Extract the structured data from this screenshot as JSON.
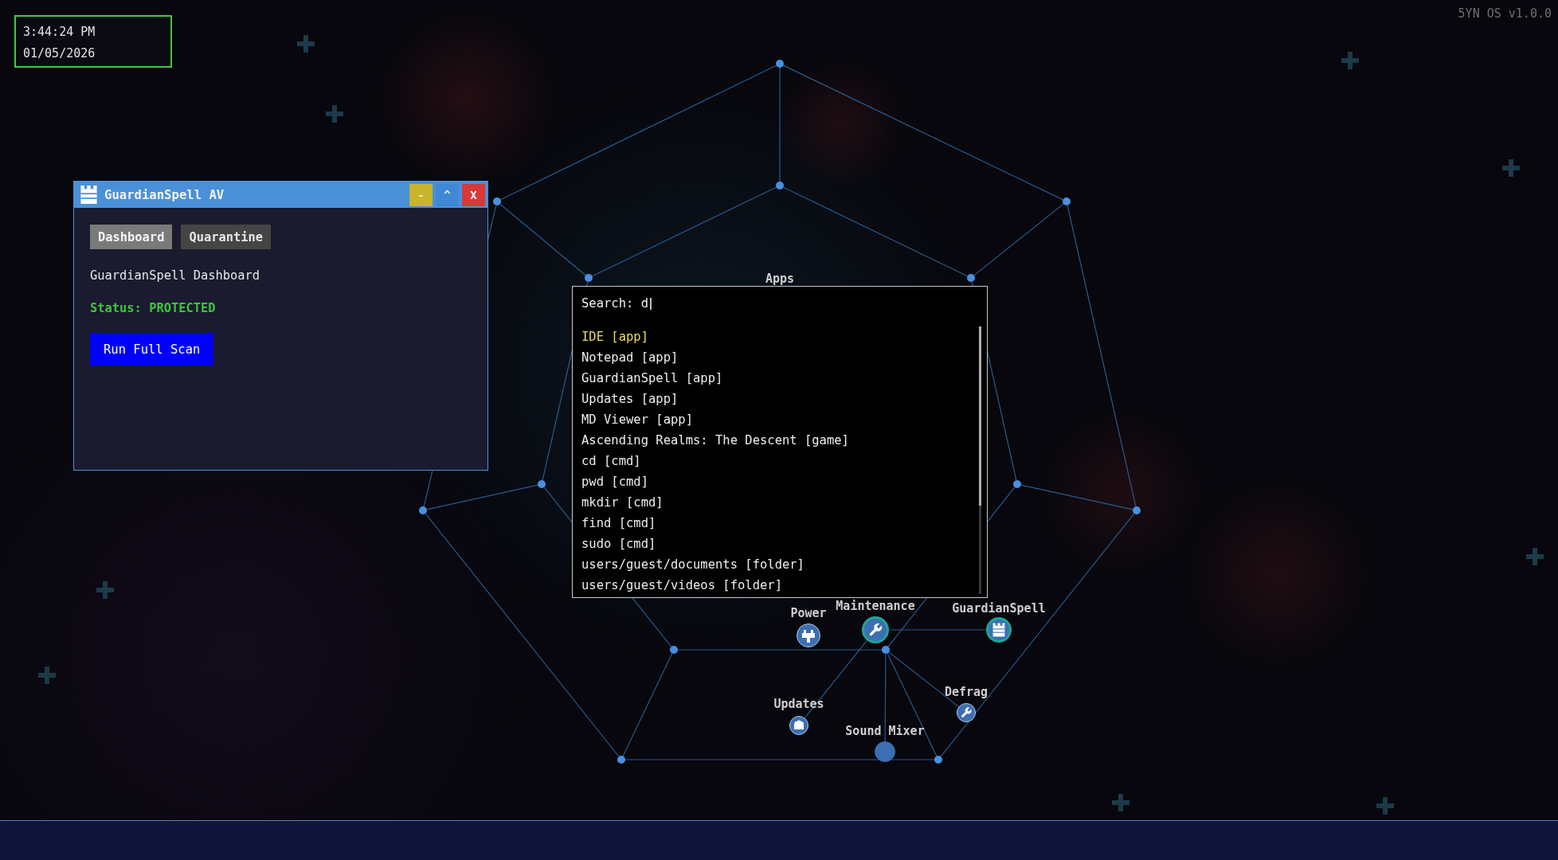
{
  "clock": {
    "time": "3:44:24 PM",
    "date": "01/05/2026"
  },
  "version": "5YN OS v1.0.0",
  "window": {
    "title": "GuardianSpell AV",
    "controls": [
      {
        "kind": "minimize",
        "label": "-"
      },
      {
        "kind": "maximize",
        "label": "^"
      },
      {
        "kind": "close",
        "label": "X"
      }
    ],
    "tabs": [
      {
        "label": "Dashboard",
        "selected": true
      },
      {
        "label": "Quarantine",
        "selected": false
      }
    ],
    "heading": "GuardianSpell Dashboard",
    "status": {
      "text": "Status: PROTECTED",
      "kind": "protected"
    },
    "action_button": "Run Full Scan"
  },
  "graph": {
    "hub_label": "Apps",
    "nodes": [
      {
        "label": "Power",
        "kind": "power",
        "active": false
      },
      {
        "label": "Maintenance",
        "kind": "tools",
        "active": true
      },
      {
        "label": "GuardianSpell",
        "kind": "security",
        "active": true
      },
      {
        "label": "Updates",
        "kind": "updates",
        "active": false
      },
      {
        "label": "Defrag",
        "kind": "disk",
        "active": false
      },
      {
        "label": "Sound Mixer",
        "kind": "audio",
        "active": false
      }
    ]
  },
  "launcher": {
    "search": {
      "label": "Search:",
      "value": "d"
    },
    "results": [
      {
        "label": "IDE [app]",
        "selected": true
      },
      {
        "label": "Notepad [app]",
        "selected": false
      },
      {
        "label": "GuardianSpell [app]",
        "selected": false
      },
      {
        "label": "Updates [app]",
        "selected": false
      },
      {
        "label": "MD Viewer [app]",
        "selected": false
      },
      {
        "label": "Ascending Realms: The Descent [game]",
        "selected": false
      },
      {
        "label": "cd [cmd]",
        "selected": false
      },
      {
        "label": "pwd [cmd]",
        "selected": false
      },
      {
        "label": "mkdir [cmd]",
        "selected": false
      },
      {
        "label": "find [cmd]",
        "selected": false
      },
      {
        "label": "sudo [cmd]",
        "selected": false
      },
      {
        "label": "users/guest/documents [folder]",
        "selected": false
      },
      {
        "label": "users/guest/videos [folder]",
        "selected": false
      }
    ]
  }
}
